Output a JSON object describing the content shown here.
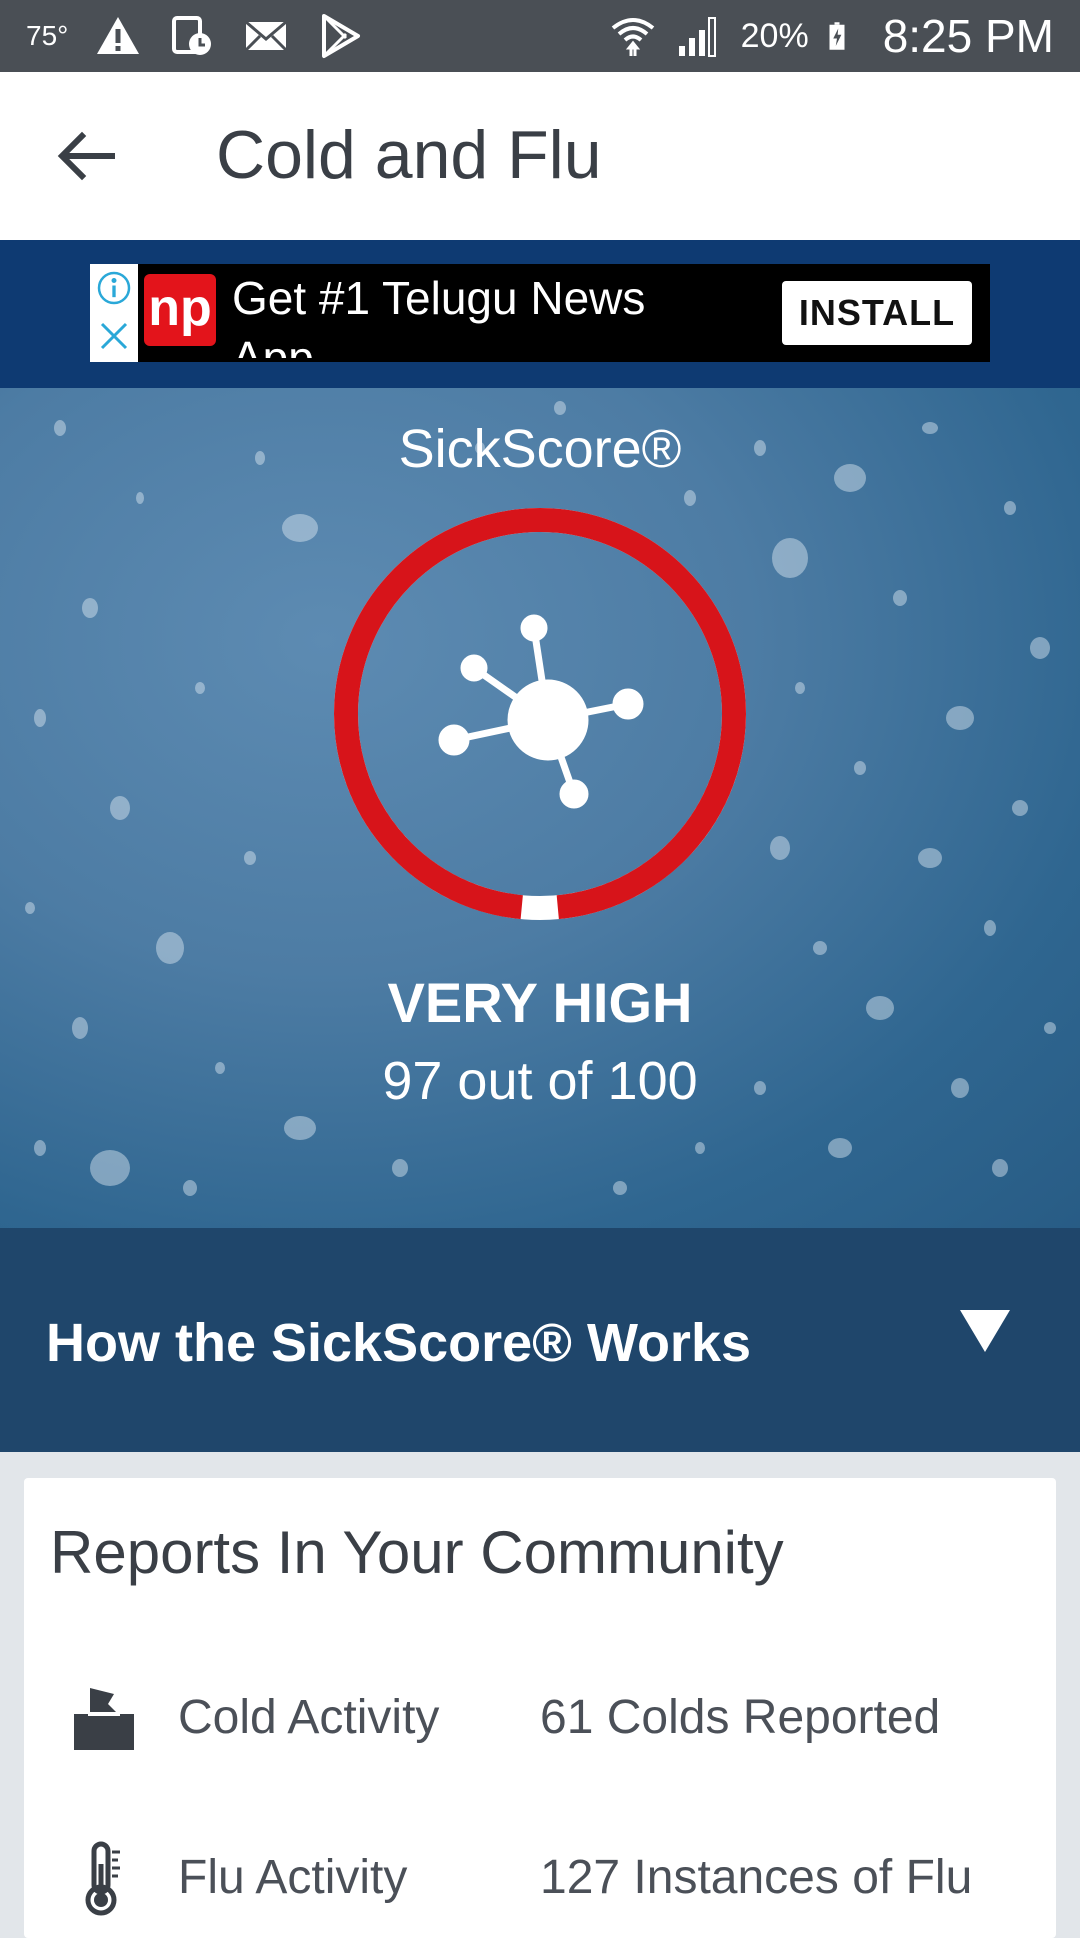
{
  "status_bar": {
    "temperature": "75°",
    "battery_percent": "20%",
    "time": "8:25 PM",
    "icons": [
      "alert-icon",
      "calendar-clock-icon",
      "mail-icon",
      "play-store-icon",
      "wifi-icon",
      "signal-icon",
      "battery-charging-icon"
    ]
  },
  "app_bar": {
    "title": "Cold and Flu",
    "back_icon": "arrow-left-icon"
  },
  "ad": {
    "logo_text": "np",
    "text": "Get #1 Telugu News App",
    "install_label": "INSTALL",
    "icons": [
      "info-icon",
      "close-icon"
    ]
  },
  "sickscore": {
    "label": "SickScore®",
    "level": "VERY HIGH",
    "score_text": "97 out of 100",
    "score_value": 97,
    "score_max": 100,
    "ring_color": "#d7141a",
    "center_icon": "virus-icon"
  },
  "how_it_works": {
    "label": "How the SickScore® Works",
    "toggle_icon": "triangle-down-icon"
  },
  "reports": {
    "title": "Reports In Your Community",
    "items": [
      {
        "icon": "tissue-box-icon",
        "label": "Cold Activity",
        "value": "61 Colds Reported"
      },
      {
        "icon": "thermometer-icon",
        "label": "Flu Activity",
        "value": "127 Instances of Flu"
      }
    ]
  }
}
